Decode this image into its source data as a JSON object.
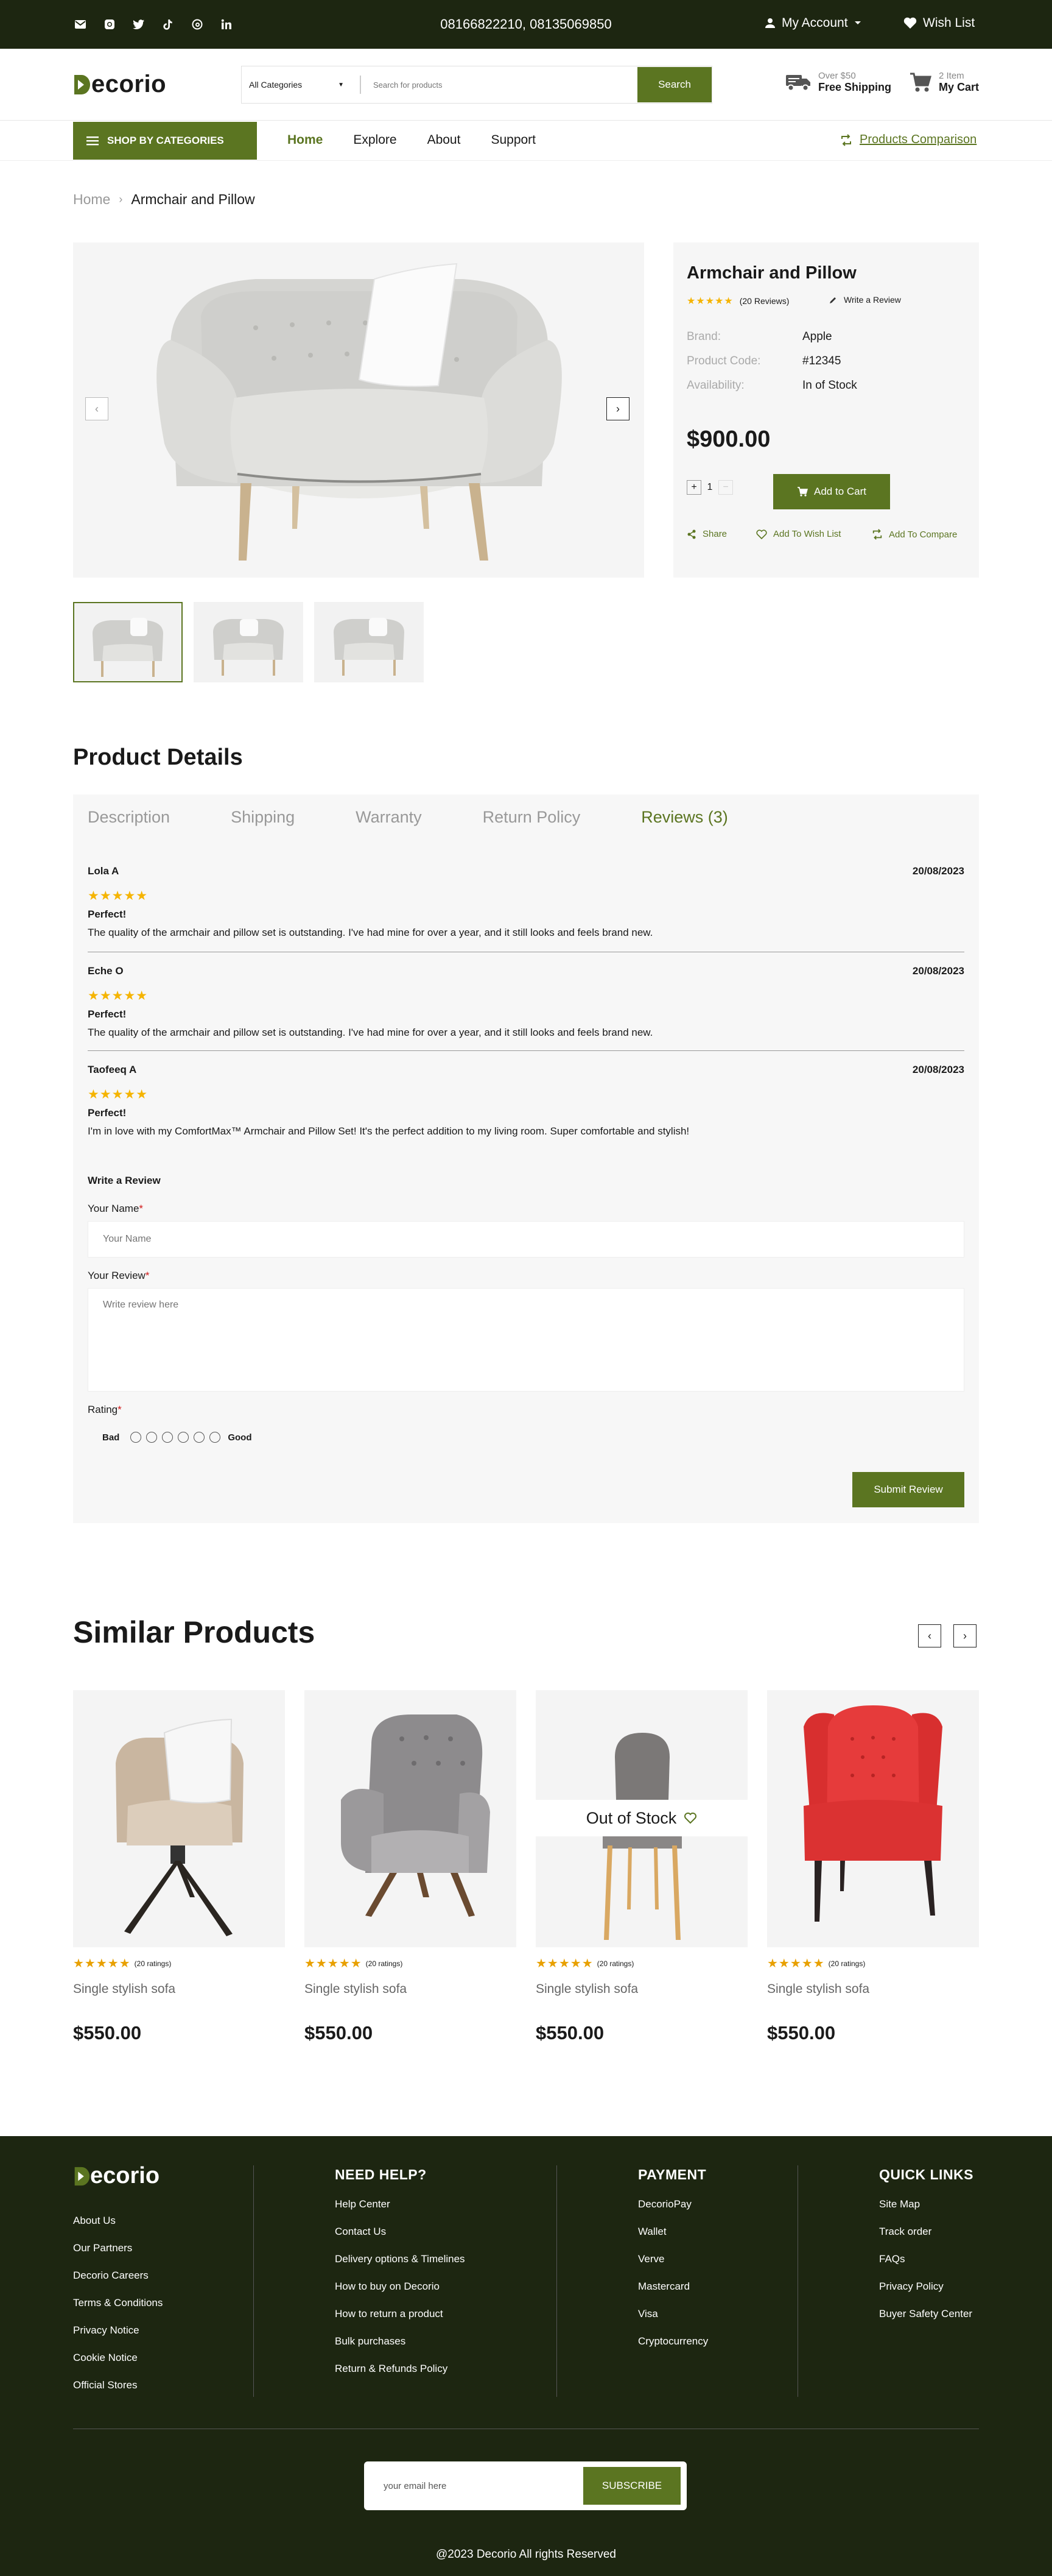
{
  "topbar": {
    "social_icons": [
      "mail-icon",
      "instagram-icon",
      "twitter-icon",
      "tiktok-icon",
      "threads-icon",
      "linkedin-icon"
    ],
    "phones": "08166822210,  08135069850",
    "account_label": "My Account",
    "wishlist_label": "Wish List"
  },
  "header": {
    "logo_text": "ecorio",
    "logo_letter": "D",
    "category_select": "All Categories",
    "search_placeholder": "Search for products",
    "search_button": "Search",
    "shipping_small": "Over $50",
    "shipping_bold": "Free Shipping",
    "cart_small": "2 Item",
    "cart_bold": "My Cart"
  },
  "nav": {
    "shop_by_categories": "SHOP BY CATEGORIES",
    "links": [
      "Home",
      "Explore",
      "About",
      "Support"
    ],
    "compare": "Products Comparison"
  },
  "breadcrumb": {
    "home": "Home",
    "current": "Armchair and Pillow"
  },
  "product": {
    "title": "Armchair and Pillow",
    "rating_stars": "★★★★★",
    "reviews_count": "(20 Reviews)",
    "write_review": "Write a Review",
    "brand_label": "Brand:",
    "brand": "Apple",
    "code_label": "Product Code:",
    "code": "#12345",
    "availability_label": "Availability:",
    "availability": "In of Stock",
    "price": "$900.00",
    "quantity": "1",
    "add_to_cart": "Add to Cart",
    "share": "Share",
    "add_to_wishlist": "Add To Wish List",
    "add_to_compare": "Add To Compare"
  },
  "details": {
    "heading": "Product Details",
    "tabs": [
      "Description",
      "Shipping",
      "Warranty",
      "Return Policy",
      "Reviews (3)"
    ],
    "reviews": [
      {
        "name": "Lola A",
        "date": "20/08/2023",
        "stars": "★★★★★",
        "headline": "Perfect!",
        "text": "The quality of the armchair and pillow set is outstanding. I've had mine for over a year, and it still looks and feels brand new."
      },
      {
        "name": "Eche O",
        "date": "20/08/2023",
        "stars": "★★★★★",
        "headline": "Perfect!",
        "text": "The quality of the armchair and pillow set is outstanding. I've had mine for over a year, and it still looks and feels brand new."
      },
      {
        "name": "Taofeeq A",
        "date": "20/08/2023",
        "stars": "★★★★★",
        "headline": "Perfect!",
        "text": "I'm in love with my ComfortMax™ Armchair and Pillow Set! It's the perfect addition to my living room. Super comfortable and stylish!"
      }
    ],
    "form": {
      "title": "Write a Review",
      "name_label": "Your Name",
      "name_placeholder": "Your Name",
      "review_label": "Your Review",
      "review_placeholder": "Write review here",
      "rating_label": "Rating",
      "bad": "Bad",
      "good": "Good",
      "submit": "Submit Review"
    }
  },
  "similar": {
    "heading": "Similar Products",
    "products": [
      {
        "stars": "★★★★★",
        "ratings": "(20 ratings)",
        "name": "Single stylish sofa",
        "price": "$550.00"
      },
      {
        "stars": "★★★★★",
        "ratings": "(20 ratings)",
        "name": "Single stylish sofa",
        "price": "$550.00"
      },
      {
        "stars": "★★★★★",
        "ratings": "(20 ratings)",
        "name": "Single stylish sofa",
        "price": "$550.00",
        "badge": "Out of Stock"
      },
      {
        "stars": "★★★★★",
        "ratings": "(20 ratings)",
        "name": "Single stylish sofa",
        "price": "$550.00"
      }
    ]
  },
  "footer": {
    "logo_text": "ecorio",
    "logo_letter": "D",
    "company_links": [
      "About Us",
      "Our Partners",
      "Decorio Careers",
      "Terms & Conditions",
      "Privacy Notice",
      "Cookie Notice",
      "Official Stores"
    ],
    "help_heading": "NEED HELP?",
    "help_links": [
      "Help Center",
      "Contact Us",
      "Delivery options & Timelines",
      "How to buy on Decorio",
      "How to return a product",
      "Bulk purchases",
      "Return & Refunds Policy"
    ],
    "payment_heading": "PAYMENT",
    "payment_links": [
      "DecorioPay",
      "Wallet",
      "Verve",
      "Mastercard",
      "Visa",
      "Cryptocurrency"
    ],
    "quick_heading": "QUICK LINKS",
    "quick_links": [
      "Site Map",
      "Track order",
      "FAQs",
      "Privacy Policy",
      "Buyer Safety Center"
    ],
    "email_placeholder": "your email here",
    "subscribe": "SUBSCRIBE",
    "copyright": "@2023 Decorio All rights Reserved"
  },
  "colors": {
    "brand_green": "#5b7521",
    "dark_bg": "#1d2611",
    "star": "#f5b400"
  }
}
